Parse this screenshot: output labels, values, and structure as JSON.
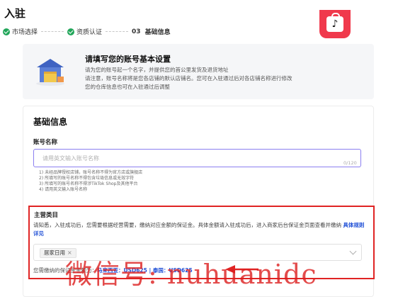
{
  "header": {
    "title": "入驻",
    "steps": [
      {
        "label": "市场选择",
        "status": "done"
      },
      {
        "label": "资质认证",
        "status": "done"
      },
      {
        "number": "03",
        "label": "基础信息",
        "status": "current"
      }
    ]
  },
  "info_card": {
    "title": "请填写您的账号基本设置",
    "lines": [
      "请为您的账号起一个名字，并提供您的首公里发货及退货地址",
      "请注意，账号名称将是您各店铺的默认店铺名。您可在入驻通过后对各店铺名称进行修改",
      "您的仓库信息也可在入驻通过后调整"
    ]
  },
  "basic_info": {
    "section_title": "基础信息",
    "account_name": {
      "label": "账号名称",
      "placeholder": "请用英文输入账号名称",
      "value": "",
      "counter": "0/120"
    },
    "rules": [
      "1) 未经品牌授权店铺，账号名称不得为官方店或旗舰店",
      "2) 所填写的账号名称不得包含垃圾信息或无效字符",
      "3) 所填写的账号名称不得涉TikTok Shop及其他平台",
      "4) 请用英文输入账号名称"
    ]
  },
  "main_category": {
    "label": "主营类目",
    "description": "请知悉，入驻成功后，您需要根据经营需要，缴纳对应金额的保证金。具体金额请入驻成功后，进入商家后台保证金页面查看并缴纳",
    "link": "具体规则详见",
    "selected_tag": "居家日用",
    "deposit_prefix": "您需缴纳的保证金金额为：",
    "deposit_values": "马来西亚：USD625 | 泰国：USD625"
  },
  "watermark": "微信号: nuhuanidc",
  "colors": {
    "accent": "#8b7ff0",
    "success": "#22a65a",
    "highlight": "#e02424",
    "link": "#1f4fd6",
    "brand": "#f0394c"
  },
  "icons": [
    "check-icon",
    "tiktok-shop-logo",
    "store-illustration",
    "close-icon",
    "chevron-down-icon",
    "arrow-annotation"
  ]
}
